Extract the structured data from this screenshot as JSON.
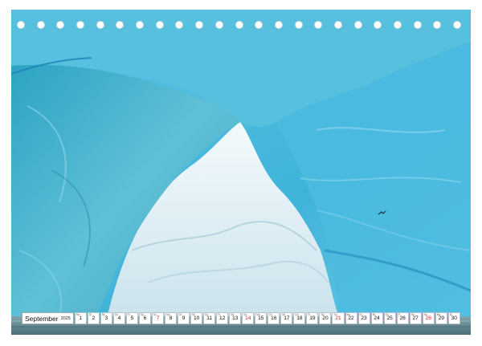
{
  "calendar": {
    "month": "September",
    "year": "2025",
    "days": [
      {
        "n": "1",
        "wd": "Mo"
      },
      {
        "n": "2",
        "wd": "Di"
      },
      {
        "n": "3",
        "wd": "Mi"
      },
      {
        "n": "4",
        "wd": "Do"
      },
      {
        "n": "5",
        "wd": "Fr"
      },
      {
        "n": "6",
        "wd": "Sa"
      },
      {
        "n": "7",
        "wd": "So"
      },
      {
        "n": "8",
        "wd": "Mo"
      },
      {
        "n": "9",
        "wd": "Di"
      },
      {
        "n": "10",
        "wd": "Mi"
      },
      {
        "n": "11",
        "wd": "Do"
      },
      {
        "n": "12",
        "wd": "Fr"
      },
      {
        "n": "13",
        "wd": "Sa"
      },
      {
        "n": "14",
        "wd": "So"
      },
      {
        "n": "15",
        "wd": "Mo"
      },
      {
        "n": "16",
        "wd": "Di"
      },
      {
        "n": "17",
        "wd": "Mi"
      },
      {
        "n": "18",
        "wd": "Do"
      },
      {
        "n": "19",
        "wd": "Fr"
      },
      {
        "n": "20",
        "wd": "Sa"
      },
      {
        "n": "21",
        "wd": "So"
      },
      {
        "n": "22",
        "wd": "Mo"
      },
      {
        "n": "23",
        "wd": "Di"
      },
      {
        "n": "24",
        "wd": "Mi"
      },
      {
        "n": "25",
        "wd": "Do"
      },
      {
        "n": "26",
        "wd": "Fr"
      },
      {
        "n": "27",
        "wd": "Sa"
      },
      {
        "n": "28",
        "wd": "So"
      },
      {
        "n": "29",
        "wd": "Mo"
      },
      {
        "n": "30",
        "wd": "Di"
      }
    ]
  },
  "photo": {
    "subject": "iceberg-arch-icon",
    "colors": {
      "ice_deep": "#1f8fb0",
      "ice_mid": "#4fb9d6",
      "ice_light": "#8fd6ea",
      "ice_pale": "#d6eef5",
      "inner_ice": "#e8f3f8",
      "water": "#5a7f88"
    }
  },
  "binding": {
    "hole_count": 23,
    "hole_icon": "binding-hole-icon"
  }
}
